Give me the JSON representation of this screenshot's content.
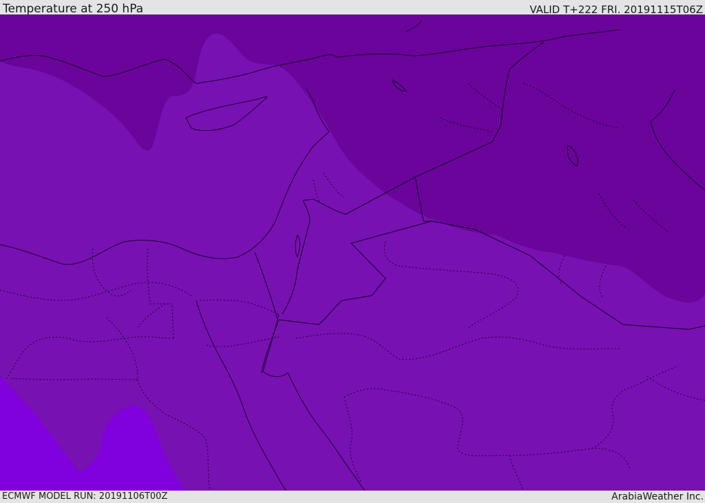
{
  "header": {
    "title": "Temperature at 250 hPa",
    "valid": "VALID T+222 FRI. 20191115T06Z"
  },
  "footer": {
    "model_run": "ECMWF MODEL RUN: 20191106T00Z",
    "credit": "ArabiaWeather Inc."
  },
  "map": {
    "field": "temperature-250hPa",
    "colors": {
      "cold_band": "#6a049a",
      "mid_band": "#7811b2",
      "warm_band": "#8100de",
      "coastline": "#1c0030",
      "border": "#14002a"
    }
  }
}
